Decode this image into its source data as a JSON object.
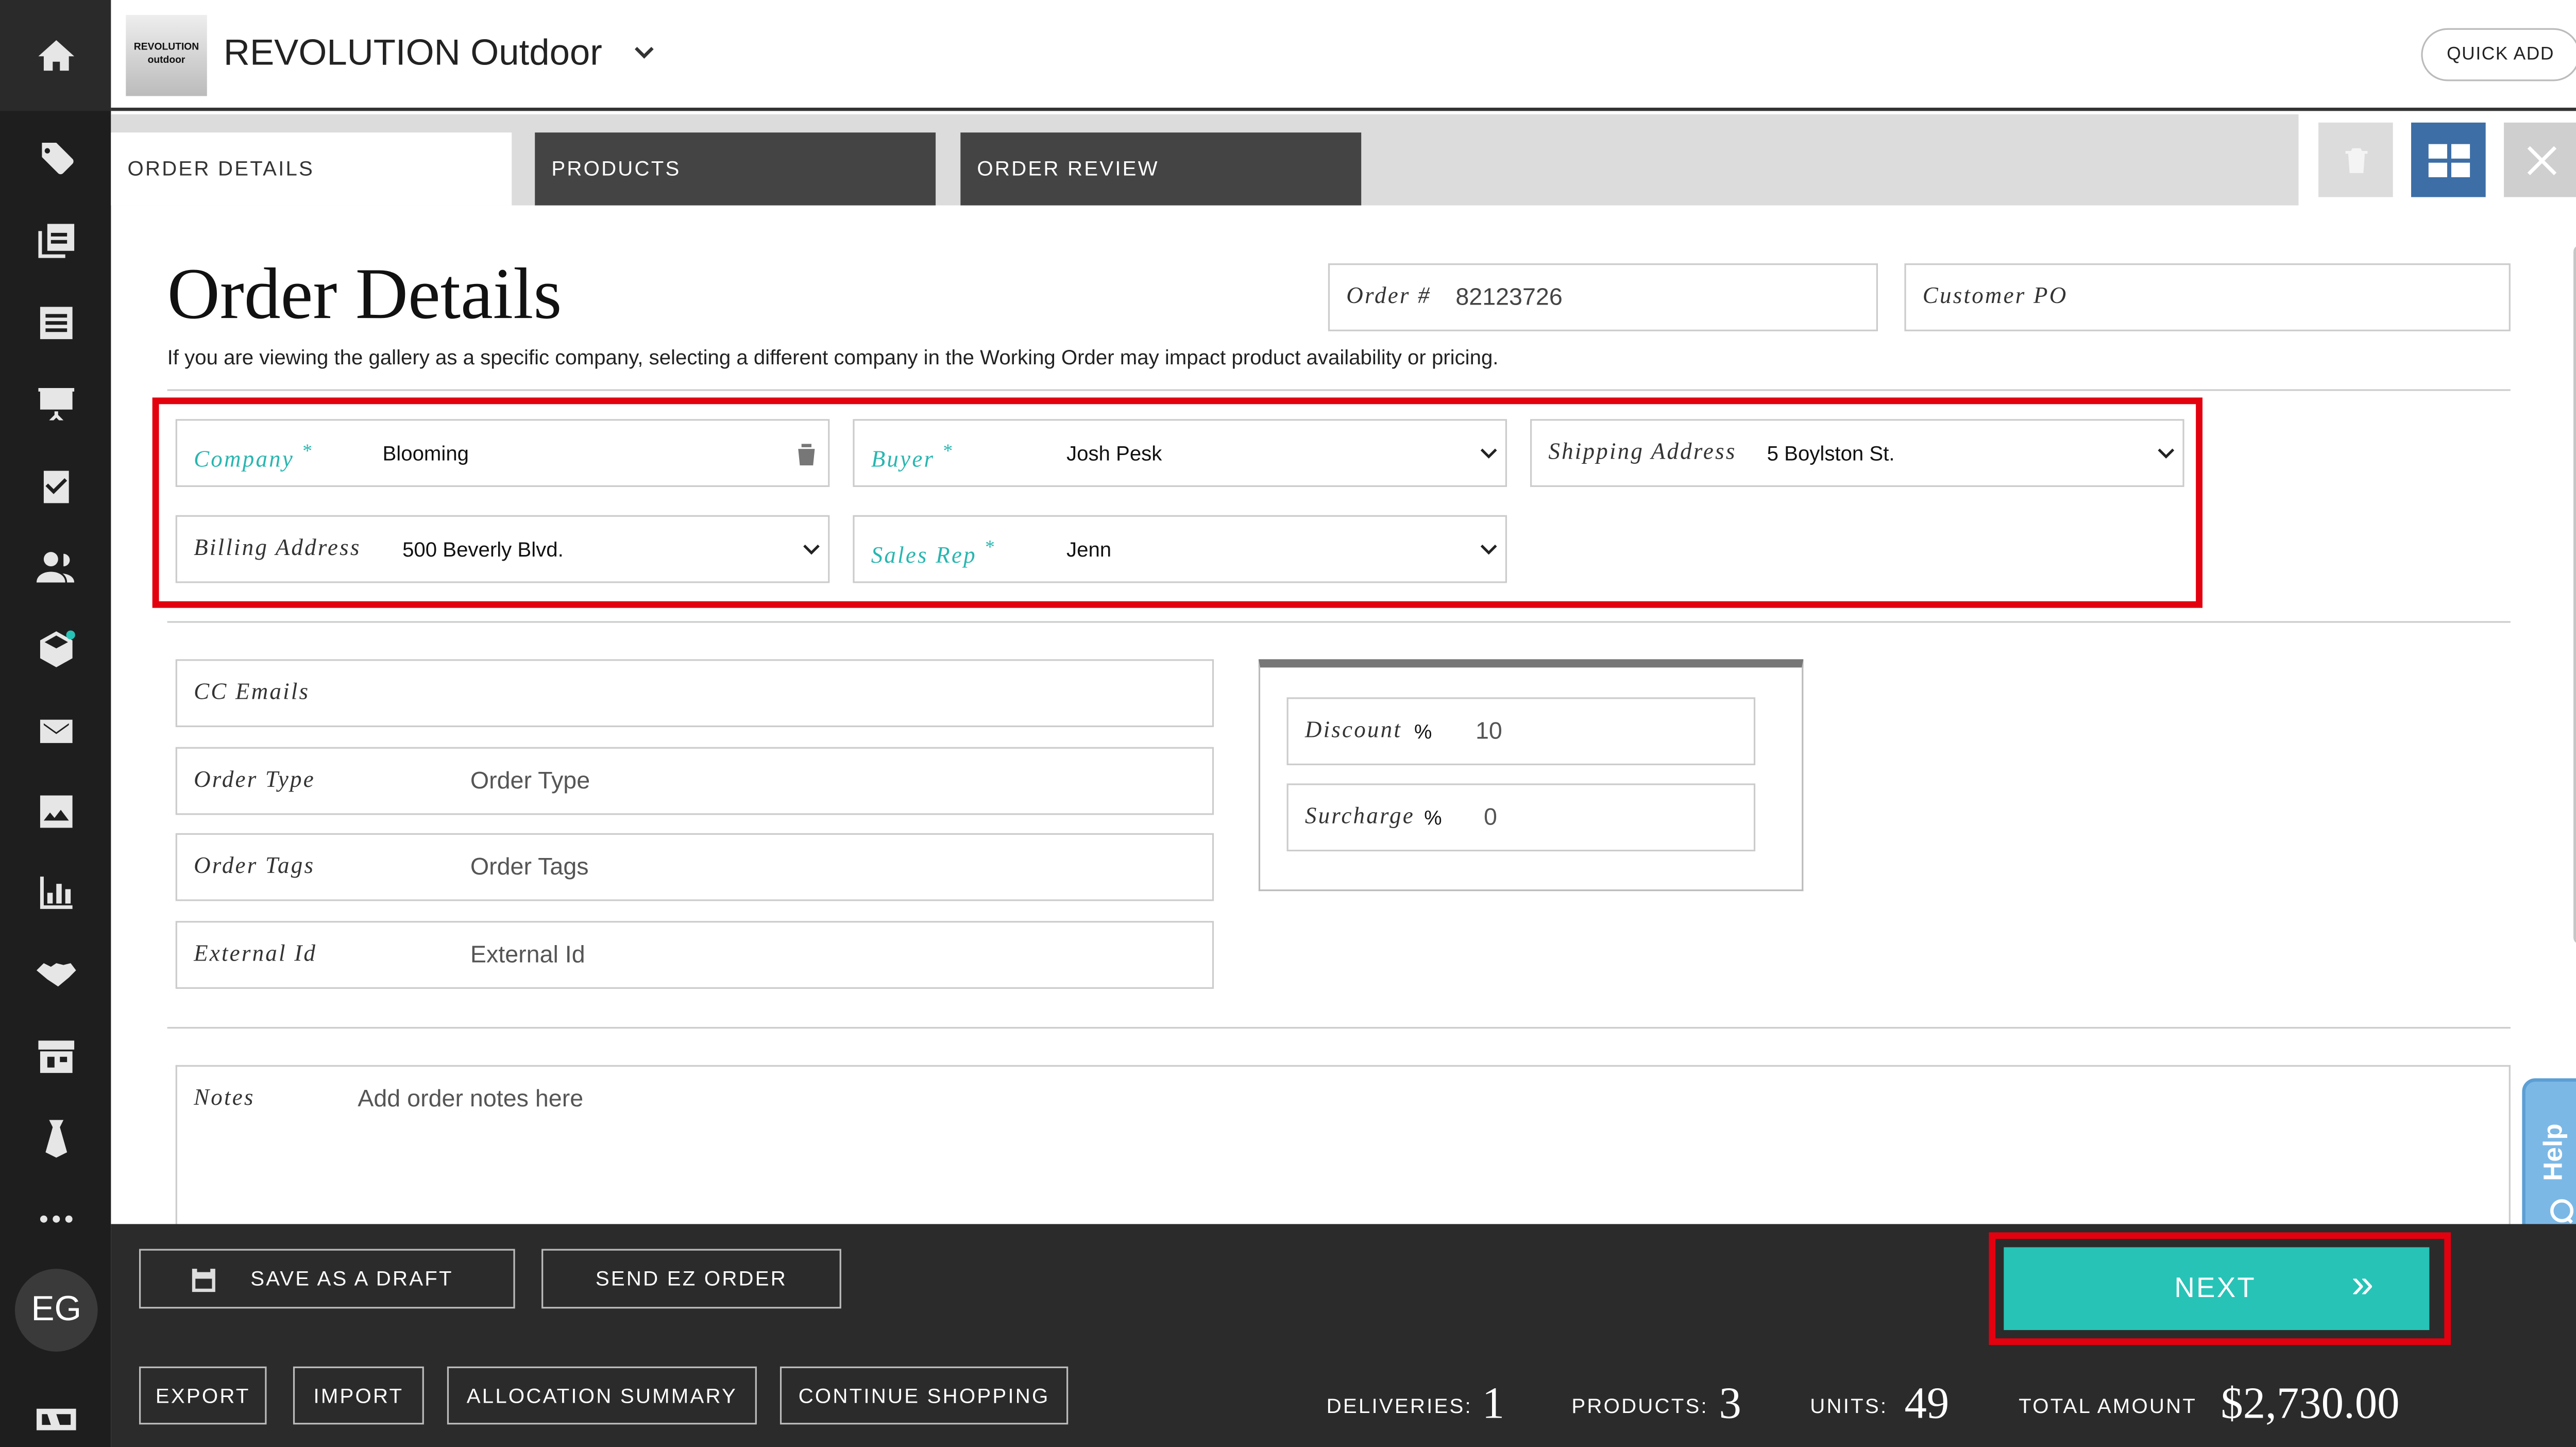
{
  "header": {
    "logo_text": "REVOLUTION outdoor",
    "company_name": "REVOLUTION Outdoor",
    "quick_add_label": "QUICK ADD"
  },
  "tabs": [
    {
      "label": "ORDER DETAILS",
      "active": true
    },
    {
      "label": "PRODUCTS",
      "active": false
    },
    {
      "label": "ORDER REVIEW",
      "active": false
    }
  ],
  "sidebar": {
    "icons": [
      "home-icon",
      "tag-icon",
      "catalog-icon",
      "list-icon",
      "presentation-icon",
      "checklist-icon",
      "users-icon",
      "box-icon",
      "mail-icon",
      "image-icon",
      "chart-icon",
      "handshake-icon",
      "store-icon",
      "tie-icon",
      "more-icon",
      "window-icon"
    ],
    "avatar_initials": "EG"
  },
  "page": {
    "title": "Order Details",
    "subtitle": "If you are viewing the gallery as a specific company, selecting a different company in the Working Order may impact product availability or pricing.",
    "order_number_label": "Order #",
    "order_number": "82123726",
    "customer_po_label": "Customer PO"
  },
  "fields": {
    "company": {
      "label": "Company",
      "value": "Blooming"
    },
    "buyer": {
      "label": "Buyer",
      "value": "Josh Pesk"
    },
    "shipping_address": {
      "label": "Shipping Address",
      "value": "5 Boylston St."
    },
    "billing_address": {
      "label": "Billing Address",
      "value": "500 Beverly Blvd."
    },
    "sales_rep": {
      "label": "Sales Rep",
      "value": "Jenn"
    },
    "required_mark": "*",
    "cc_emails": {
      "label": "CC Emails",
      "value": ""
    },
    "order_type": {
      "label": "Order Type",
      "placeholder": "Order Type"
    },
    "order_tags": {
      "label": "Order Tags",
      "placeholder": "Order Tags"
    },
    "external_id": {
      "label": "External Id",
      "placeholder": "External Id"
    },
    "discount": {
      "label": "Discount",
      "unit": "%",
      "value": "10"
    },
    "surcharge": {
      "label": "Surcharge",
      "unit": "%",
      "value": "0"
    },
    "notes": {
      "label": "Notes",
      "placeholder": "Add order notes here"
    }
  },
  "footer": {
    "save_draft_label": "SAVE AS A DRAFT",
    "send_ez_order_label": "SEND EZ ORDER",
    "export_label": "EXPORT",
    "import_label": "IMPORT",
    "allocation_summary_label": "ALLOCATION SUMMARY",
    "continue_shopping_label": "CONTINUE SHOPPING",
    "next_label": "NEXT",
    "next_icon": "»",
    "deliveries_label": "DELIVERIES:",
    "deliveries_value": "1",
    "products_label": "PRODUCTS:",
    "products_value": "3",
    "units_label": "UNITS:",
    "units_value": "49",
    "total_label": "TOTAL AMOUNT",
    "total_value": "$2,730.00"
  },
  "help_label": "Help",
  "colors": {
    "accent_teal": "#27c3b7",
    "required_label": "#29b6b0",
    "highlight_red": "#e3000f",
    "grid_button_blue": "#3d6ea6",
    "dark_bar": "#2b2b2b"
  }
}
